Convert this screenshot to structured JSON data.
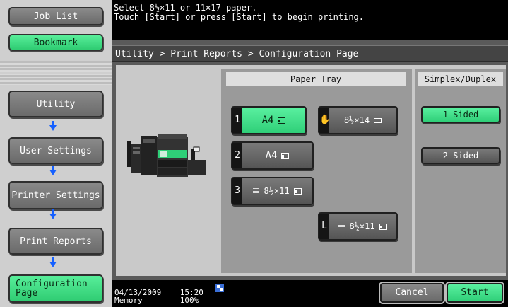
{
  "left_nav": {
    "job_list": "Job List",
    "bookmark": "Bookmark",
    "items": [
      "Utility",
      "User Settings",
      "Printer Settings",
      "Print Reports"
    ],
    "current": [
      "Configuration",
      "Page"
    ]
  },
  "message": {
    "line1": "Select 8½×11 or 11×17 paper.",
    "line2": "Touch [Start] or press [Start] to begin printing."
  },
  "breadcrumb": "Utility > Print Reports > Configuration Page",
  "paper_tray": {
    "header": "Paper Tray",
    "trays": [
      {
        "num": "1",
        "size": "A4",
        "selected": true
      },
      {
        "num": "",
        "size": "8½×14",
        "selected": false
      },
      {
        "num": "2",
        "size": "A4",
        "selected": false
      },
      {
        "num": "3",
        "size": "8½×11",
        "selected": false
      },
      {
        "num": "L",
        "size": "8½×11",
        "selected": false
      }
    ]
  },
  "duplex": {
    "header": "Simplex/Duplex",
    "one_sided": "1-Sided",
    "two_sided": "2-Sided",
    "selected": "1-Sided"
  },
  "status": {
    "date": "04/13/2009",
    "time": "15:20",
    "memory_label": "Memory",
    "memory_value": "100%"
  },
  "actions": {
    "cancel": "Cancel",
    "start": "Start"
  },
  "colors": {
    "selected_green": "#3ddc84",
    "arrow_blue": "#1560ff"
  }
}
